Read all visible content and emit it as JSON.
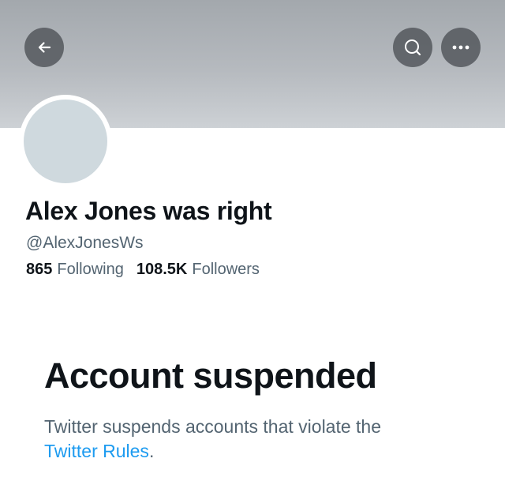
{
  "header": {
    "back_icon": "arrow-left-icon",
    "search_icon": "search-icon",
    "more_icon": "more-horizontal-icon"
  },
  "profile": {
    "display_name": "Alex Jones was right",
    "handle": "@AlexJonesWs",
    "following_count": "865",
    "following_label": "Following",
    "followers_count": "108.5K",
    "followers_label": "Followers"
  },
  "suspension": {
    "title": "Account suspended",
    "message": "Twitter suspends accounts that violate the",
    "link_text": "Twitter Rules",
    "message_end": "."
  },
  "colors": {
    "link": "#1d9bf0",
    "secondary_text": "#536471",
    "primary_text": "#0f1419",
    "avatar_placeholder": "#cfd9de"
  }
}
